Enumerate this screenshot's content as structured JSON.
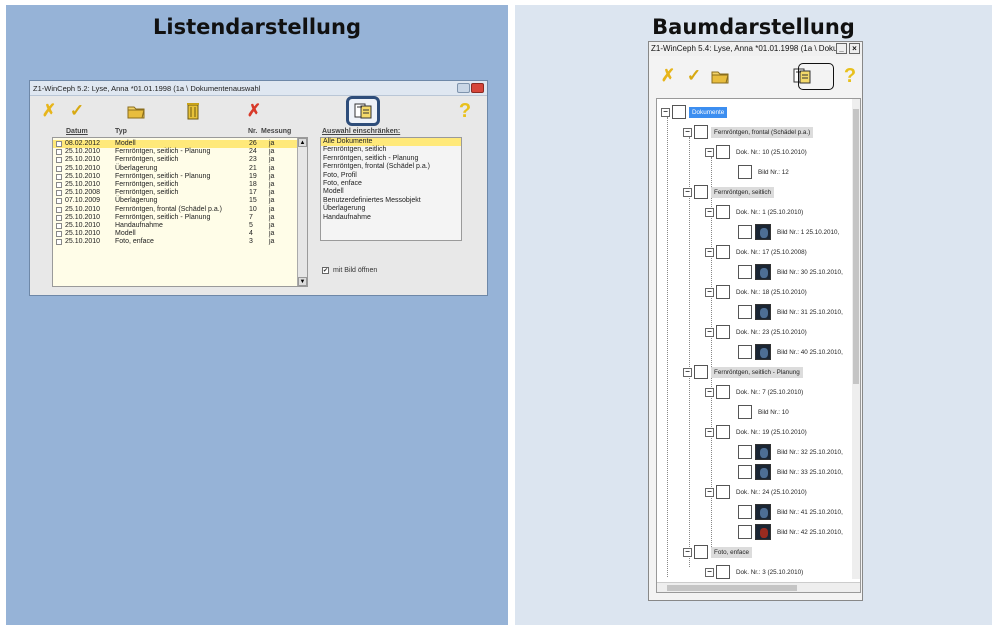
{
  "left": {
    "heading": "Listendarstellung",
    "window_title": "Z1-WinCeph 5.2: Lyse, Anna *01.01.1998 (1a \\ Dokumentenauswahl",
    "columns": {
      "datum": "Datum",
      "typ": "Typ",
      "nr": "Nr.",
      "messung": "Messung"
    },
    "rows": [
      {
        "datum": "08.02.2012",
        "typ": "Modell",
        "nr": "26",
        "messung": "ja",
        "selected": true
      },
      {
        "datum": "25.10.2010",
        "typ": "Fernröntgen, seitlich - Planung",
        "nr": "24",
        "messung": "ja"
      },
      {
        "datum": "25.10.2010",
        "typ": "Fernröntgen, seitlich",
        "nr": "23",
        "messung": "ja"
      },
      {
        "datum": "25.10.2010",
        "typ": "Überlagerung",
        "nr": "21",
        "messung": "ja"
      },
      {
        "datum": "25.10.2010",
        "typ": "Fernröntgen, seitlich - Planung",
        "nr": "19",
        "messung": "ja"
      },
      {
        "datum": "25.10.2010",
        "typ": "Fernröntgen, seitlich",
        "nr": "18",
        "messung": "ja"
      },
      {
        "datum": "25.10.2008",
        "typ": "Fernröntgen, seitlich",
        "nr": "17",
        "messung": "ja"
      },
      {
        "datum": "07.10.2009",
        "typ": "Überlagerung",
        "nr": "15",
        "messung": "ja"
      },
      {
        "datum": "25.10.2010",
        "typ": "Fernröntgen, frontal (Schädel p.a.)",
        "nr": "10",
        "messung": "ja"
      },
      {
        "datum": "25.10.2010",
        "typ": "Fernröntgen, seitlich - Planung",
        "nr": "7",
        "messung": "ja"
      },
      {
        "datum": "25.10.2010",
        "typ": "Handaufnahme",
        "nr": "5",
        "messung": "ja"
      },
      {
        "datum": "25.10.2010",
        "typ": "Modell",
        "nr": "4",
        "messung": "ja"
      },
      {
        "datum": "25.10.2010",
        "typ": "Foto, enface",
        "nr": "3",
        "messung": "ja"
      }
    ],
    "filter_title": "Auswahl einschränken:",
    "filter_items": [
      "Alle Dokumente",
      "Fernröntgen, seitlich",
      "Fernröntgen, seitlich - Planung",
      "Fernröntgen, frontal (Schädel p.a.)",
      "Foto, Profil",
      "Foto, enface",
      "Modell",
      "Benutzerdefiniertes Messobjekt",
      "Überlagerung",
      "Handaufnahme"
    ],
    "checkbox_label": "mit Bild öffnen",
    "checkbox_mark": "✔"
  },
  "right": {
    "heading": "Baumdarstellung",
    "window_title": "Z1-WinCeph 5.4: Lyse, Anna *01.01.1998 (1a \\ Doku",
    "tree": [
      {
        "label": "Dokumente",
        "style": "blue"
      },
      {
        "label": "Fernröntgen, frontal (Schädel p.a.)",
        "style": "grey"
      },
      {
        "label": "Dok. Nr.: 10 (25.10.2010)"
      },
      {
        "label": "Bild Nr.: 12"
      },
      {
        "label": "Fernröntgen, seitlich",
        "style": "grey"
      },
      {
        "label": "Dok. Nr.: 1 (25.10.2010)"
      },
      {
        "label": "Bild Nr.: 1 25.10.2010,"
      },
      {
        "label": "Dok. Nr.: 17 (25.10.2008)"
      },
      {
        "label": "Bild Nr.: 30 25.10.2010,"
      },
      {
        "label": "Dok. Nr.: 18 (25.10.2010)"
      },
      {
        "label": "Bild Nr.: 31 25.10.2010,"
      },
      {
        "label": "Dok. Nr.: 23 (25.10.2010)"
      },
      {
        "label": "Bild Nr.: 40 25.10.2010,"
      },
      {
        "label": "Fernröntgen, seitlich - Planung",
        "style": "grey"
      },
      {
        "label": "Dok. Nr.: 7 (25.10.2010)"
      },
      {
        "label": "Bild Nr.: 10"
      },
      {
        "label": "Dok. Nr.: 19 (25.10.2010)"
      },
      {
        "label": "Bild Nr.: 32 25.10.2010,"
      },
      {
        "label": "Bild Nr.: 33 25.10.2010,"
      },
      {
        "label": "Dok. Nr.: 24 (25.10.2010)"
      },
      {
        "label": "Bild Nr.: 41 25.10.2010,"
      },
      {
        "label": "Bild Nr.: 42 25.10.2010,"
      },
      {
        "label": "Foto, enface",
        "style": "grey"
      },
      {
        "label": "Dok. Nr.: 3 (25.10.2010)"
      }
    ]
  },
  "colors": {
    "left_panel": "#96b3d7",
    "right_panel": "#dce5f0",
    "selection": "#ffe97a",
    "tree_selection": "#3c8ef0"
  }
}
